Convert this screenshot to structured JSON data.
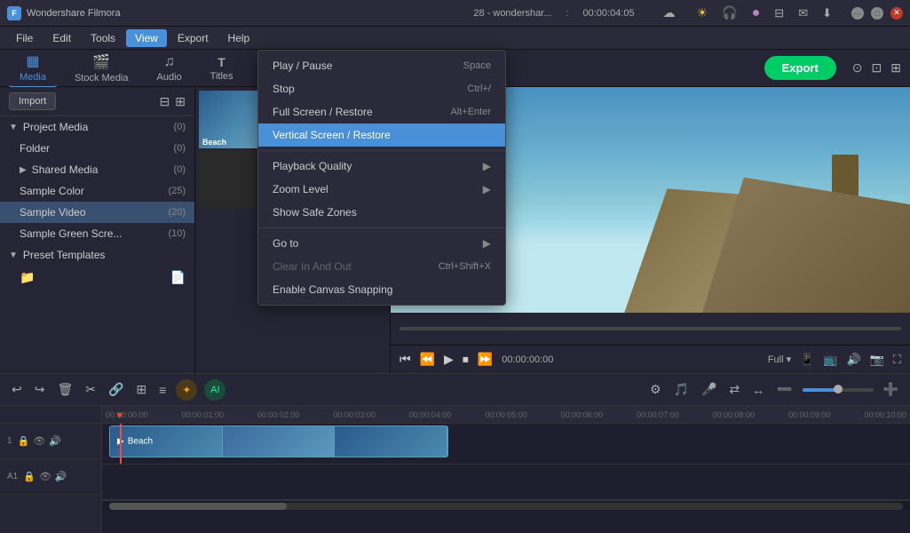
{
  "app": {
    "name": "Wondershare Filmora",
    "icon": "F",
    "title_text": "28 - wondershar...",
    "time_code": "00:00:04:05"
  },
  "titlebar": {
    "minimize": "—",
    "maximize": "□",
    "close": "✕",
    "cloud_icon": "☁",
    "sun_icon": "☀",
    "headphone_icon": "🎧",
    "account_icon": "●",
    "bookmark_icon": "🔖",
    "mail_icon": "✉",
    "download_icon": "⬇"
  },
  "menubar": {
    "items": [
      "File",
      "Edit",
      "Tools",
      "View",
      "Export",
      "Help"
    ]
  },
  "toolbar": {
    "tabs": [
      {
        "id": "media",
        "label": "Media",
        "icon": "▦",
        "active": true
      },
      {
        "id": "stock",
        "label": "Stock Media",
        "icon": "🎬"
      },
      {
        "id": "audio",
        "label": "Audio",
        "icon": "♫"
      },
      {
        "id": "titles",
        "label": "Titles",
        "icon": "T"
      }
    ],
    "export_label": "Export"
  },
  "left_panel": {
    "import_label": "Import",
    "filter_icon": "⊟",
    "grid_icon": "⊞",
    "tree": [
      {
        "label": "Project Media",
        "count": "(0)",
        "expanded": true,
        "level": 0
      },
      {
        "label": "Folder",
        "count": "(0)",
        "level": 1
      },
      {
        "label": "Shared Media",
        "count": "(0)",
        "level": 1,
        "arrow": "▶"
      },
      {
        "label": "Sample Color",
        "count": "(25)",
        "level": 1
      },
      {
        "label": "Sample Video",
        "count": "(20)",
        "level": 1,
        "selected": true
      },
      {
        "label": "Sample Green Scre...",
        "count": "(10)",
        "level": 1
      },
      {
        "label": "Preset Templates",
        "count": "",
        "level": 0,
        "expanded": true
      },
      {
        "label": "new-folder-icon",
        "level": 1,
        "is_icon": true
      }
    ]
  },
  "media_thumbs": [
    {
      "id": "beach",
      "label": "Beach",
      "type": "beach"
    },
    {
      "id": "dark1",
      "label": "",
      "type": "dark"
    },
    {
      "id": "dark2",
      "label": "",
      "type": "dark"
    },
    {
      "id": "dark3",
      "label": "",
      "type": "dark"
    }
  ],
  "preview": {
    "time_current": "00:00:00:00",
    "time_total": "",
    "controls": [
      "⏮",
      "⏪",
      "▶",
      "⏹",
      "⏩"
    ],
    "quality_label": "Full",
    "preview_icons": [
      "📱",
      "📺",
      "🔊",
      "📷",
      "⛶"
    ]
  },
  "timeline": {
    "toolbar_btns": [
      {
        "icon": "↩",
        "label": "undo"
      },
      {
        "icon": "↪",
        "label": "redo"
      },
      {
        "icon": "🗑",
        "label": "delete"
      },
      {
        "icon": "✂",
        "label": "cut"
      },
      {
        "icon": "🔗",
        "label": "link"
      },
      {
        "icon": "⊞",
        "label": "split"
      },
      {
        "icon": "≡",
        "label": "more"
      },
      {
        "icon": "⚙",
        "label": "settings"
      },
      {
        "icon": "🎵",
        "label": "music"
      },
      {
        "icon": "🎤",
        "label": "record"
      },
      {
        "icon": "⇄",
        "label": "swap"
      },
      {
        "icon": "↔",
        "label": "extend"
      },
      {
        "icon": "➕",
        "label": "zoom-in"
      },
      {
        "icon": "➖",
        "label": "zoom-out"
      }
    ],
    "ruler_marks": [
      "00:00:00:00",
      "00:00:01:00",
      "00:00:02:00",
      "00:00:03:00",
      "00:00:04:00",
      "00:00:05:00",
      "00:00:06:00",
      "00:00:07:00",
      "00:00:08:00",
      "00:00:09:00",
      "00:00:10:00"
    ],
    "tracks": [
      {
        "type": "video",
        "icons": [
          "🔒",
          "👁",
          "🔊"
        ],
        "clip": {
          "name": "Beach",
          "start_pct": 3,
          "width_pct": 40,
          "type": "beach"
        }
      },
      {
        "type": "audio",
        "icons": [
          "🔒",
          "👁",
          "🔊"
        ],
        "clip": null
      }
    ]
  },
  "view_menu": {
    "sections": [
      {
        "items": [
          {
            "label": "Play / Pause",
            "shortcut": "Space",
            "arrow": "",
            "disabled": false,
            "highlighted": false
          },
          {
            "label": "Stop",
            "shortcut": "Ctrl+/",
            "arrow": "",
            "disabled": false,
            "highlighted": false
          },
          {
            "label": "Full Screen / Restore",
            "shortcut": "Alt+Enter",
            "arrow": "",
            "disabled": false,
            "highlighted": false
          },
          {
            "label": "Vertical Screen / Restore",
            "shortcut": "",
            "arrow": "",
            "disabled": false,
            "highlighted": true
          }
        ]
      },
      {
        "items": [
          {
            "label": "Playback Quality",
            "shortcut": "",
            "arrow": "▶",
            "disabled": false,
            "highlighted": false
          },
          {
            "label": "Zoom Level",
            "shortcut": "",
            "arrow": "▶",
            "disabled": false,
            "highlighted": false
          },
          {
            "label": "Show Safe Zones",
            "shortcut": "",
            "arrow": "",
            "disabled": false,
            "highlighted": false
          }
        ]
      },
      {
        "items": [
          {
            "label": "Go to",
            "shortcut": "",
            "arrow": "▶",
            "disabled": false,
            "highlighted": false
          },
          {
            "label": "Clear In And Out",
            "shortcut": "Ctrl+Shift+X",
            "arrow": "",
            "disabled": true,
            "highlighted": false
          },
          {
            "label": "Enable Canvas Snapping",
            "shortcut": "",
            "arrow": "",
            "disabled": false,
            "highlighted": false
          }
        ]
      }
    ]
  }
}
